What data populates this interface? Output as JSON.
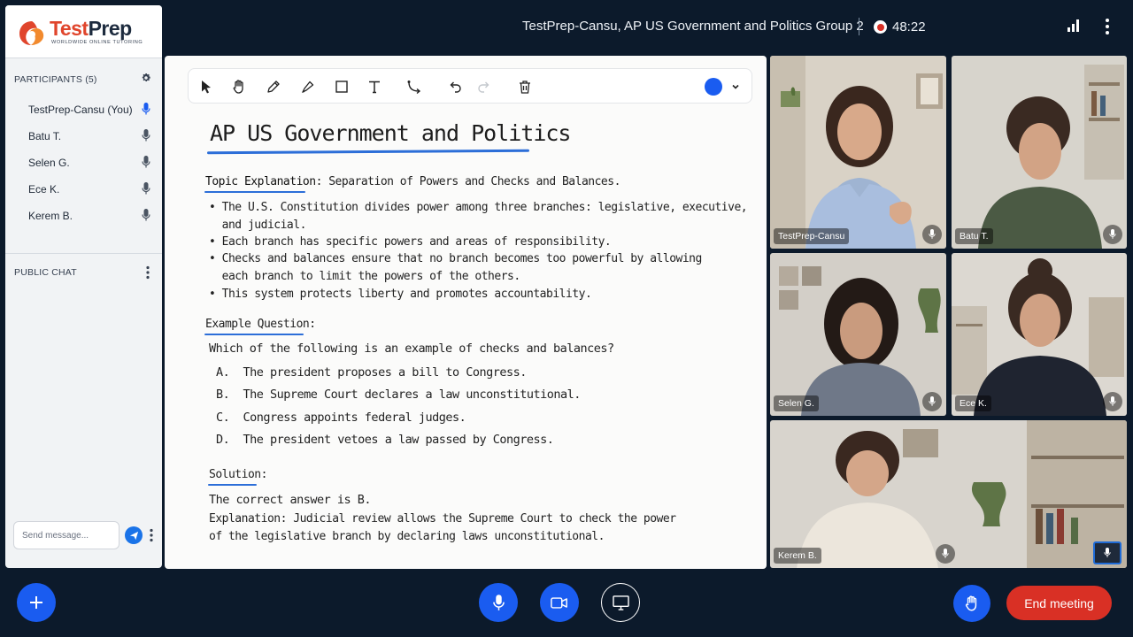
{
  "header": {
    "meeting_title": "TestPrep-Cansu, AP US Government and Politics Group 2",
    "recording_time": "48:22"
  },
  "brand": {
    "name_part1": "Test",
    "name_part2": "Prep",
    "tagline": "WORLDWIDE ONLINE TUTORING"
  },
  "participants": {
    "heading": "PARTICIPANTS (5)",
    "items": [
      {
        "name": "TestPrep-Cansu (You)",
        "mic": "active"
      },
      {
        "name": "Batu T.",
        "mic": "on"
      },
      {
        "name": "Selen G.",
        "mic": "on"
      },
      {
        "name": "Ece K.",
        "mic": "on"
      },
      {
        "name": "Kerem B.",
        "mic": "on"
      }
    ]
  },
  "chat": {
    "heading": "PUBLIC CHAT",
    "placeholder": "Send message..."
  },
  "whiteboard": {
    "title": "AP US Government and Politics",
    "topic_label": "Topic Explanation",
    "topic_text": ": Separation of Powers and Checks and Balances.",
    "bullets": [
      "• The U.S. Constitution divides power among three branches: legislative, executive,",
      "  and judicial.",
      "• Each branch has specific powers and areas of responsibility.",
      "• Checks and balances ensure that no branch becomes too powerful by allowing",
      "  each branch to limit the powers of the others.",
      "• This system protects liberty and promotes accountability."
    ],
    "example_label": "Example Question",
    "example_colon": ":",
    "question": "Which of the following is an example of checks and balances?",
    "options": [
      "A.  The president proposes a bill to Congress.",
      "B.  The Supreme Court declares a law unconstitutional.",
      "C.  Congress appoints federal judges.",
      "D.  The president vetoes a law passed by Congress."
    ],
    "solution_label": "Solution",
    "solution_colon": ":",
    "solution_lines": [
      "The correct answer is B.",
      "Explanation: Judicial review allows the Supreme Court to check the power",
      "of the legislative branch by declaring laws unconstitutional."
    ],
    "accent_color": "#1a5cf0"
  },
  "videos": [
    {
      "name": "TestPrep-Cansu"
    },
    {
      "name": "Batu T."
    },
    {
      "name": "Selen G."
    },
    {
      "name": "Ece K."
    },
    {
      "name": "Kerem B."
    }
  ],
  "controls": {
    "end_meeting_label": "End meeting",
    "end_meeting_color": "#d93025",
    "button_color": "#1a5cf0"
  }
}
